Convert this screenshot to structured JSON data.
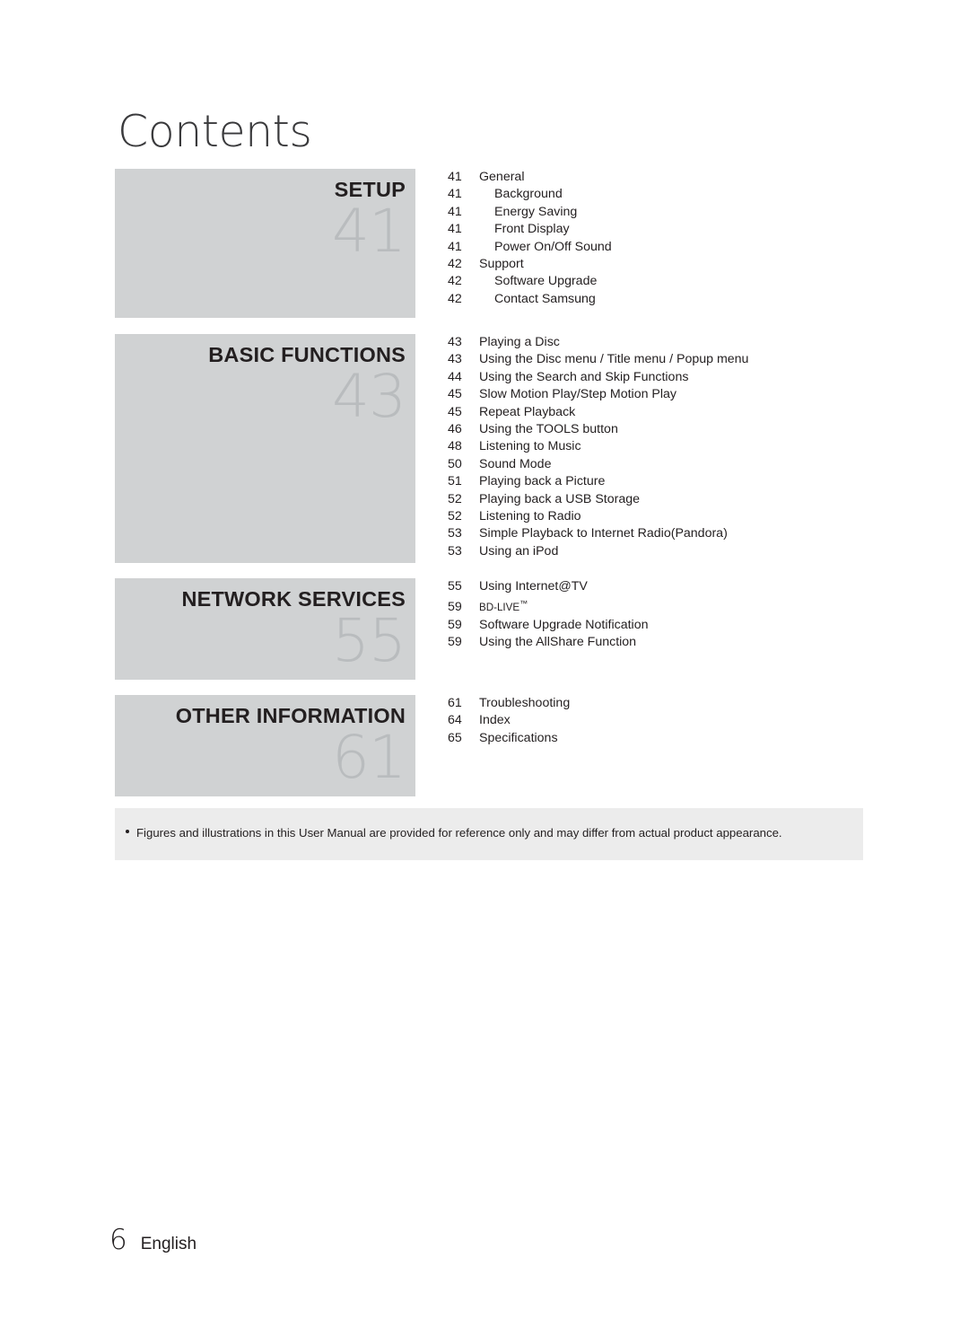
{
  "page": {
    "title": "Contents",
    "footer_page_number": "6",
    "footer_language": "English"
  },
  "colors": {
    "section_block_bg": "#d0d2d3",
    "section_number": "#b9bcbe",
    "note_bar_bg": "#ececec",
    "text": "#231f20",
    "page_bg": "#ffffff"
  },
  "sections": [
    {
      "title": "SETUP",
      "number": "41",
      "entries": [
        {
          "page": "41",
          "label": "General",
          "level": 0
        },
        {
          "page": "41",
          "label": "Background",
          "level": 1
        },
        {
          "page": "41",
          "label": "Energy Saving",
          "level": 1
        },
        {
          "page": "41",
          "label": "Front Display",
          "level": 1
        },
        {
          "page": "41",
          "label": "Power On/Off Sound",
          "level": 1
        },
        {
          "page": "42",
          "label": "Support",
          "level": 0
        },
        {
          "page": "42",
          "label": "Software Upgrade",
          "level": 1
        },
        {
          "page": "42",
          "label": "Contact Samsung",
          "level": 1
        }
      ]
    },
    {
      "title": "BASIC FUNCTIONS",
      "number": "43",
      "entries": [
        {
          "page": "43",
          "label": "Playing a Disc",
          "level": 0
        },
        {
          "page": "43",
          "label": "Using the Disc menu / Title menu / Popup menu",
          "level": 0
        },
        {
          "page": "44",
          "label": "Using the Search and Skip Functions",
          "level": 0
        },
        {
          "page": "45",
          "label": "Slow Motion Play/Step Motion Play",
          "level": 0
        },
        {
          "page": "45",
          "label": "Repeat Playback",
          "level": 0
        },
        {
          "page": "46",
          "label": "Using the TOOLS button",
          "level": 0
        },
        {
          "page": "48",
          "label": "Listening to Music",
          "level": 0
        },
        {
          "page": "50",
          "label": "Sound Mode",
          "level": 0
        },
        {
          "page": "51",
          "label": "Playing back a Picture",
          "level": 0
        },
        {
          "page": "52",
          "label": "Playing back a USB Storage",
          "level": 0
        },
        {
          "page": "52",
          "label": "Listening to Radio",
          "level": 0
        },
        {
          "page": "53",
          "label": "Simple Playback to Internet Radio(Pandora)",
          "level": 0
        },
        {
          "page": "53",
          "label": "Using an iPod",
          "level": 0
        }
      ]
    },
    {
      "title": "NETWORK SERVICES",
      "number": "55",
      "entries": [
        {
          "page": "55",
          "label": "Using Internet@TV",
          "level": 0
        },
        {
          "page": "59",
          "label": "BD-LIVE™",
          "level": 0
        },
        {
          "page": "59",
          "label": "Software Upgrade Notification",
          "level": 0
        },
        {
          "page": "59",
          "label": "Using the AllShare Function",
          "level": 0
        }
      ]
    },
    {
      "title": "OTHER INFORMATION",
      "number": "61",
      "entries": [
        {
          "page": "61",
          "label": "Troubleshooting",
          "level": 0
        },
        {
          "page": "64",
          "label": "Index",
          "level": 0
        },
        {
          "page": "65",
          "label": "Specifications",
          "level": 0
        }
      ]
    }
  ],
  "note": {
    "bullet": "•",
    "text": "Figures and illustrations in this User Manual are provided for reference only and may differ from actual product appearance."
  }
}
